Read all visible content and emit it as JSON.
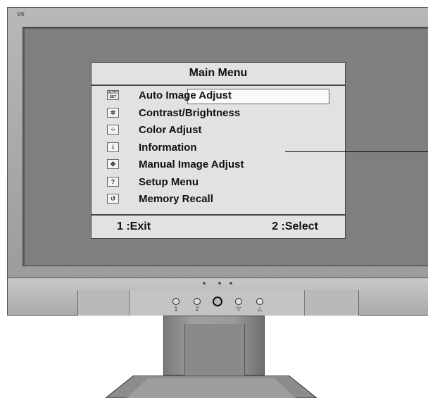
{
  "osd": {
    "title": "Main Menu",
    "items": [
      {
        "label": "Auto Image Adjust",
        "icon": "auto-set-icon",
        "selected": true
      },
      {
        "label": "Contrast/Brightness",
        "icon": "brightness-icon"
      },
      {
        "label": "Color Adjust",
        "icon": "color-icon"
      },
      {
        "label": "Information",
        "icon": "info-icon"
      },
      {
        "label": "Manual Image Adjust",
        "icon": "move-arrows-icon"
      },
      {
        "label": "Setup Menu",
        "icon": "question-icon"
      },
      {
        "label": "Memory Recall",
        "icon": "recall-icon"
      }
    ],
    "footer": {
      "exit": "1 :Exit",
      "select": "2 :Select"
    }
  },
  "icons": {
    "auto": "AUTO SET",
    "question": "?",
    "info": "i"
  },
  "colors": {
    "bezel": "#a8a8a8",
    "screen": "#7f7f7f",
    "osd_bg": "#e2e2e2",
    "text": "#111111"
  },
  "buttons": [
    {
      "name": "button-1",
      "glyph": "1"
    },
    {
      "name": "button-2",
      "glyph": "2"
    },
    {
      "name": "power-button",
      "glyph": ""
    },
    {
      "name": "down-button",
      "glyph": "▽"
    },
    {
      "name": "up-button",
      "glyph": "△"
    }
  ]
}
